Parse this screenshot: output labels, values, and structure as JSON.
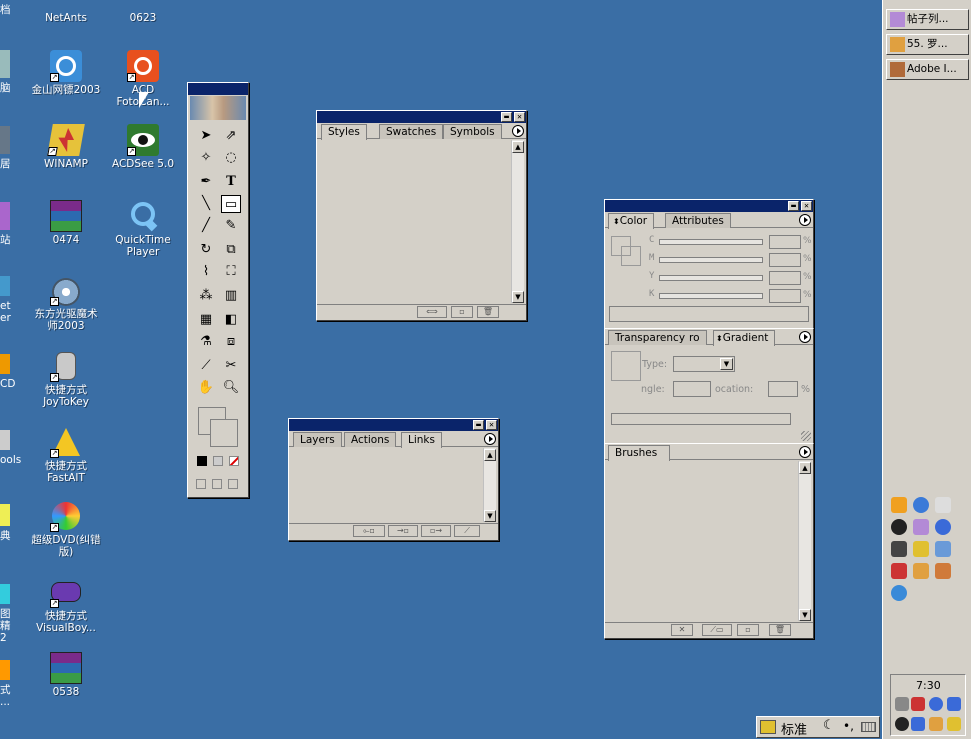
{
  "desktop": {
    "edge_labels": [
      "档",
      "脑",
      "居",
      "站",
      "et\ner",
      "CD",
      "ools",
      "典",
      "图精\n2",
      "式\n..."
    ],
    "icons_col1": [
      {
        "label": "NetAnts",
        "icon": "netants-icon"
      },
      {
        "label": "金山网镖2003",
        "icon": "kingsoft-firewall-icon"
      },
      {
        "label": "WINAMP",
        "icon": "winamp-icon"
      },
      {
        "label": "0474",
        "icon": "winrar-archive-icon"
      },
      {
        "label": "东方光驱魔术\n师2003",
        "icon": "cd-magician-icon"
      },
      {
        "label": "快捷方式\nJoyToKey",
        "icon": "joytokey-icon"
      },
      {
        "label": "快捷方式\nFastAIT",
        "icon": "fastait-icon"
      },
      {
        "label": "超级DVD(纠错\n版)",
        "icon": "super-dvd-icon"
      },
      {
        "label": "快捷方式\nVisualBoy...",
        "icon": "visualboy-icon"
      },
      {
        "label": "0538",
        "icon": "winrar-archive-icon"
      }
    ],
    "icons_col2": [
      {
        "label": "0623",
        "icon": "file-icon"
      },
      {
        "label": "ACD\nFotoCan...",
        "icon": "acd-fotocanvas-icon"
      },
      {
        "label": "ACDSee 5.0",
        "icon": "acdsee-icon"
      },
      {
        "label": "QuickTime\nPlayer",
        "icon": "quicktime-icon"
      }
    ]
  },
  "panels": {
    "styles": {
      "tabs": [
        "Styles",
        "Swatches",
        "Symbols"
      ]
    },
    "layers": {
      "tabs": [
        "Layers",
        "Actions",
        "Links"
      ]
    },
    "color": {
      "tabs": [
        "Color",
        "Attributes"
      ],
      "sliders": [
        {
          "label": "C",
          "unit": "%"
        },
        {
          "label": "M",
          "unit": "%"
        },
        {
          "label": "Y",
          "unit": "%"
        },
        {
          "label": "K",
          "unit": "%"
        }
      ]
    },
    "gradient": {
      "tabs": [
        "Transparency",
        "ro",
        "Gradient"
      ],
      "type_label": "Type:",
      "angle_label": "ngle:",
      "location_label": "ocation:",
      "location_unit": "%"
    },
    "brushes": {
      "tabs": [
        "Brushes"
      ]
    }
  },
  "taskbar": {
    "buttons": [
      "帖子列...",
      "55. 罗...",
      "Adobe I..."
    ],
    "clock": "7:30"
  },
  "ime": {
    "label": "标准"
  },
  "colors": {
    "desktop": "#3a6ea5",
    "titlebar": "#0a246a",
    "panel": "#d4d0c8"
  }
}
